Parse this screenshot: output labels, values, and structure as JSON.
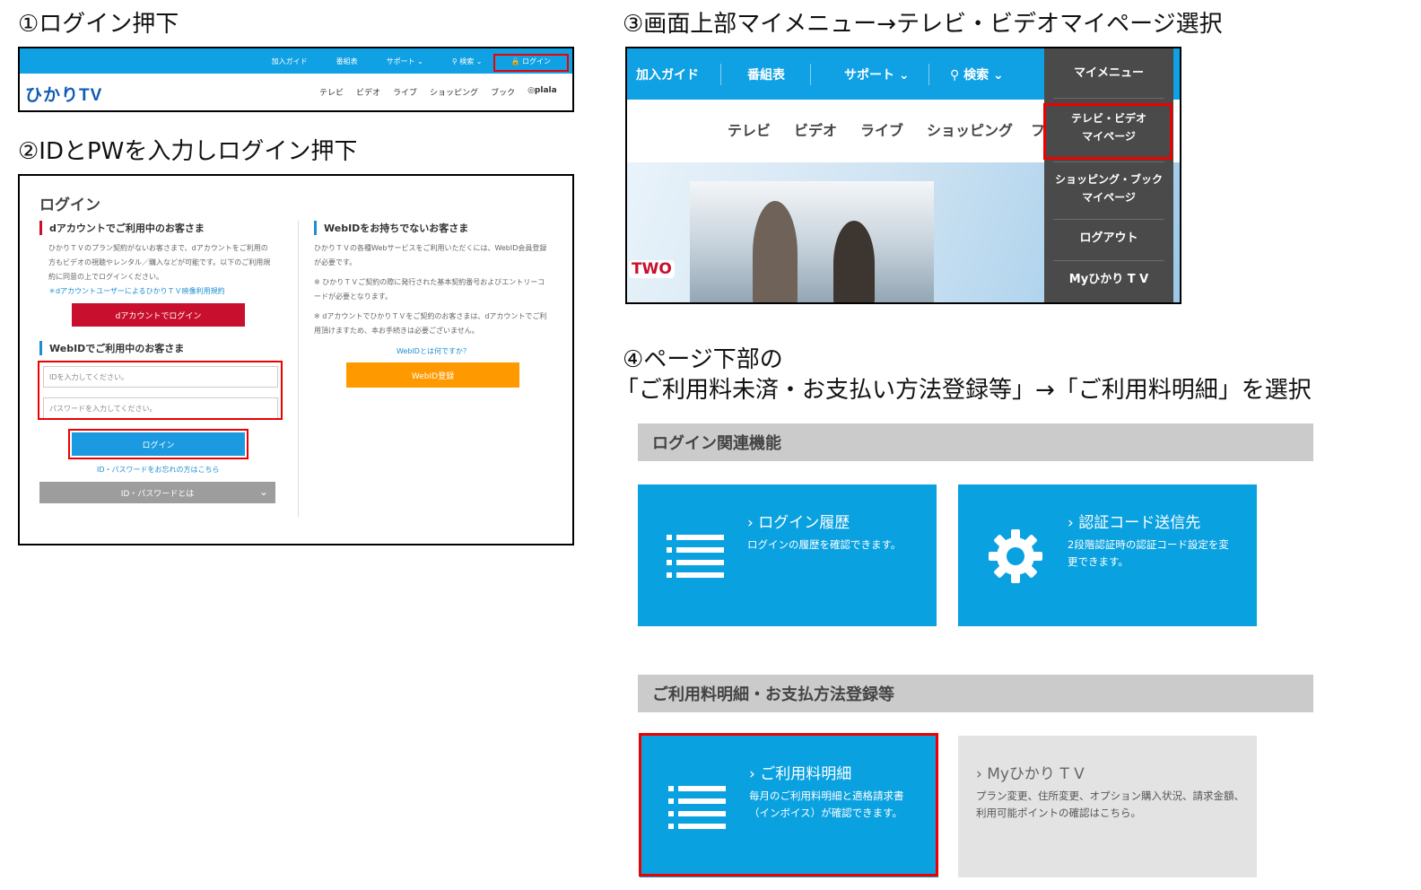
{
  "steps": {
    "s1": "①ログイン押下",
    "s2": "②IDとPWを入力しログイン押下",
    "s3": "③画面上部マイメニュー→テレビ・ビデオマイページ選択",
    "s4_line1": "④ページ下部の",
    "s4_line2": "「ご利用料未済・お支払い方法登録等」→「ご利用料明細」を選択"
  },
  "panel1": {
    "top_nav": [
      "加入ガイド",
      "番組表",
      "サポート ⌄",
      "⚲ 検索 ⌄",
      "🔒 ログイン"
    ],
    "logo": "ひかりTV",
    "categories": [
      "テレビ",
      "ビデオ",
      "ライブ",
      "ショッピング",
      "ブック",
      "◎plala"
    ]
  },
  "panel2": {
    "title": "ログイン",
    "d_section": "dアカウントでご利用中のお客さま",
    "d_text": "ひかりＴＶのプラン契約がないお客さまで、dアカウントをご利用の方もビデオの視聴やレンタル／購入などが可能です。以下のご利用規約に同意の上でログインください。",
    "d_link": "＊dアカウントユーザーによるひかりＴＶ映像利用規約",
    "d_button": "dアカウントでログイン",
    "web_section": "WebIDでご利用中のお客さま",
    "id_placeholder": "IDを入力してください。",
    "pw_placeholder": "パスワードを入力してください。",
    "login_button": "ログイン",
    "forgot_link": "ID・パスワードをお忘れの方はこちら",
    "about_bar": "ID・パスワードとは",
    "no_web_section": "WebIDをお持ちでないお客さま",
    "no_web_text1": "ひかりＴＶの各種Webサービスをご利用いただくには、WebID会員登録が必要です。",
    "no_web_text2": "※ ひかりＴＶご契約の際に発行された基本契約番号およびエントリーコードが必要となります。",
    "no_web_text3": "※ dアカウントでひかりＴＶをご契約のお客さまは、dアカウントでご利用頂けますため、本お手続きは必要ございません。",
    "webid_link": "WebIDとは何ですか？",
    "webid_button": "WebID登録"
  },
  "panel3": {
    "nav": [
      "加入ガイド",
      "番組表",
      "サポート ⌄",
      "⚲ 検索 ⌄"
    ],
    "categories": [
      "テレビ",
      "ビデオ",
      "ライブ",
      "ショッピング",
      "フ"
    ],
    "badge": "TWO",
    "menu": {
      "header": "マイメニュー",
      "tv_video_1": "テレビ・ビデオ",
      "tv_video_2": "マイページ",
      "shop_1": "ショッピング・ブック",
      "shop_2": "マイページ",
      "logout": "ログアウト",
      "my": "Myひかり T V"
    }
  },
  "panel4": {
    "section1": "ログイン関連機能",
    "tile_login_title": "› ログイン履歴",
    "tile_login_desc": "ログインの履歴を確認できます。",
    "tile_code_title": "› 認証コード送信先",
    "tile_code_desc": "2段階認証時の認証コード設定を変更できます。",
    "section2": "ご利用料明細・お支払方法登録等",
    "tile_bill_title": "› ご利用料明細",
    "tile_bill_desc": "毎月のご利用料明細と適格請求書（インボイス）が確認できます。",
    "tile_my_title": "› Myひかり T V",
    "tile_my_desc": "プラン変更、住所変更、オプション購入状況、請求金額、利用可能ポイントの確認はこちら。"
  },
  "colors": {
    "brand_blue": "#10a1e4",
    "tile_blue": "#0aa1e0",
    "highlight_red": "#ee0000",
    "d_red": "#c8102e",
    "webid_orange": "#ff9900"
  }
}
